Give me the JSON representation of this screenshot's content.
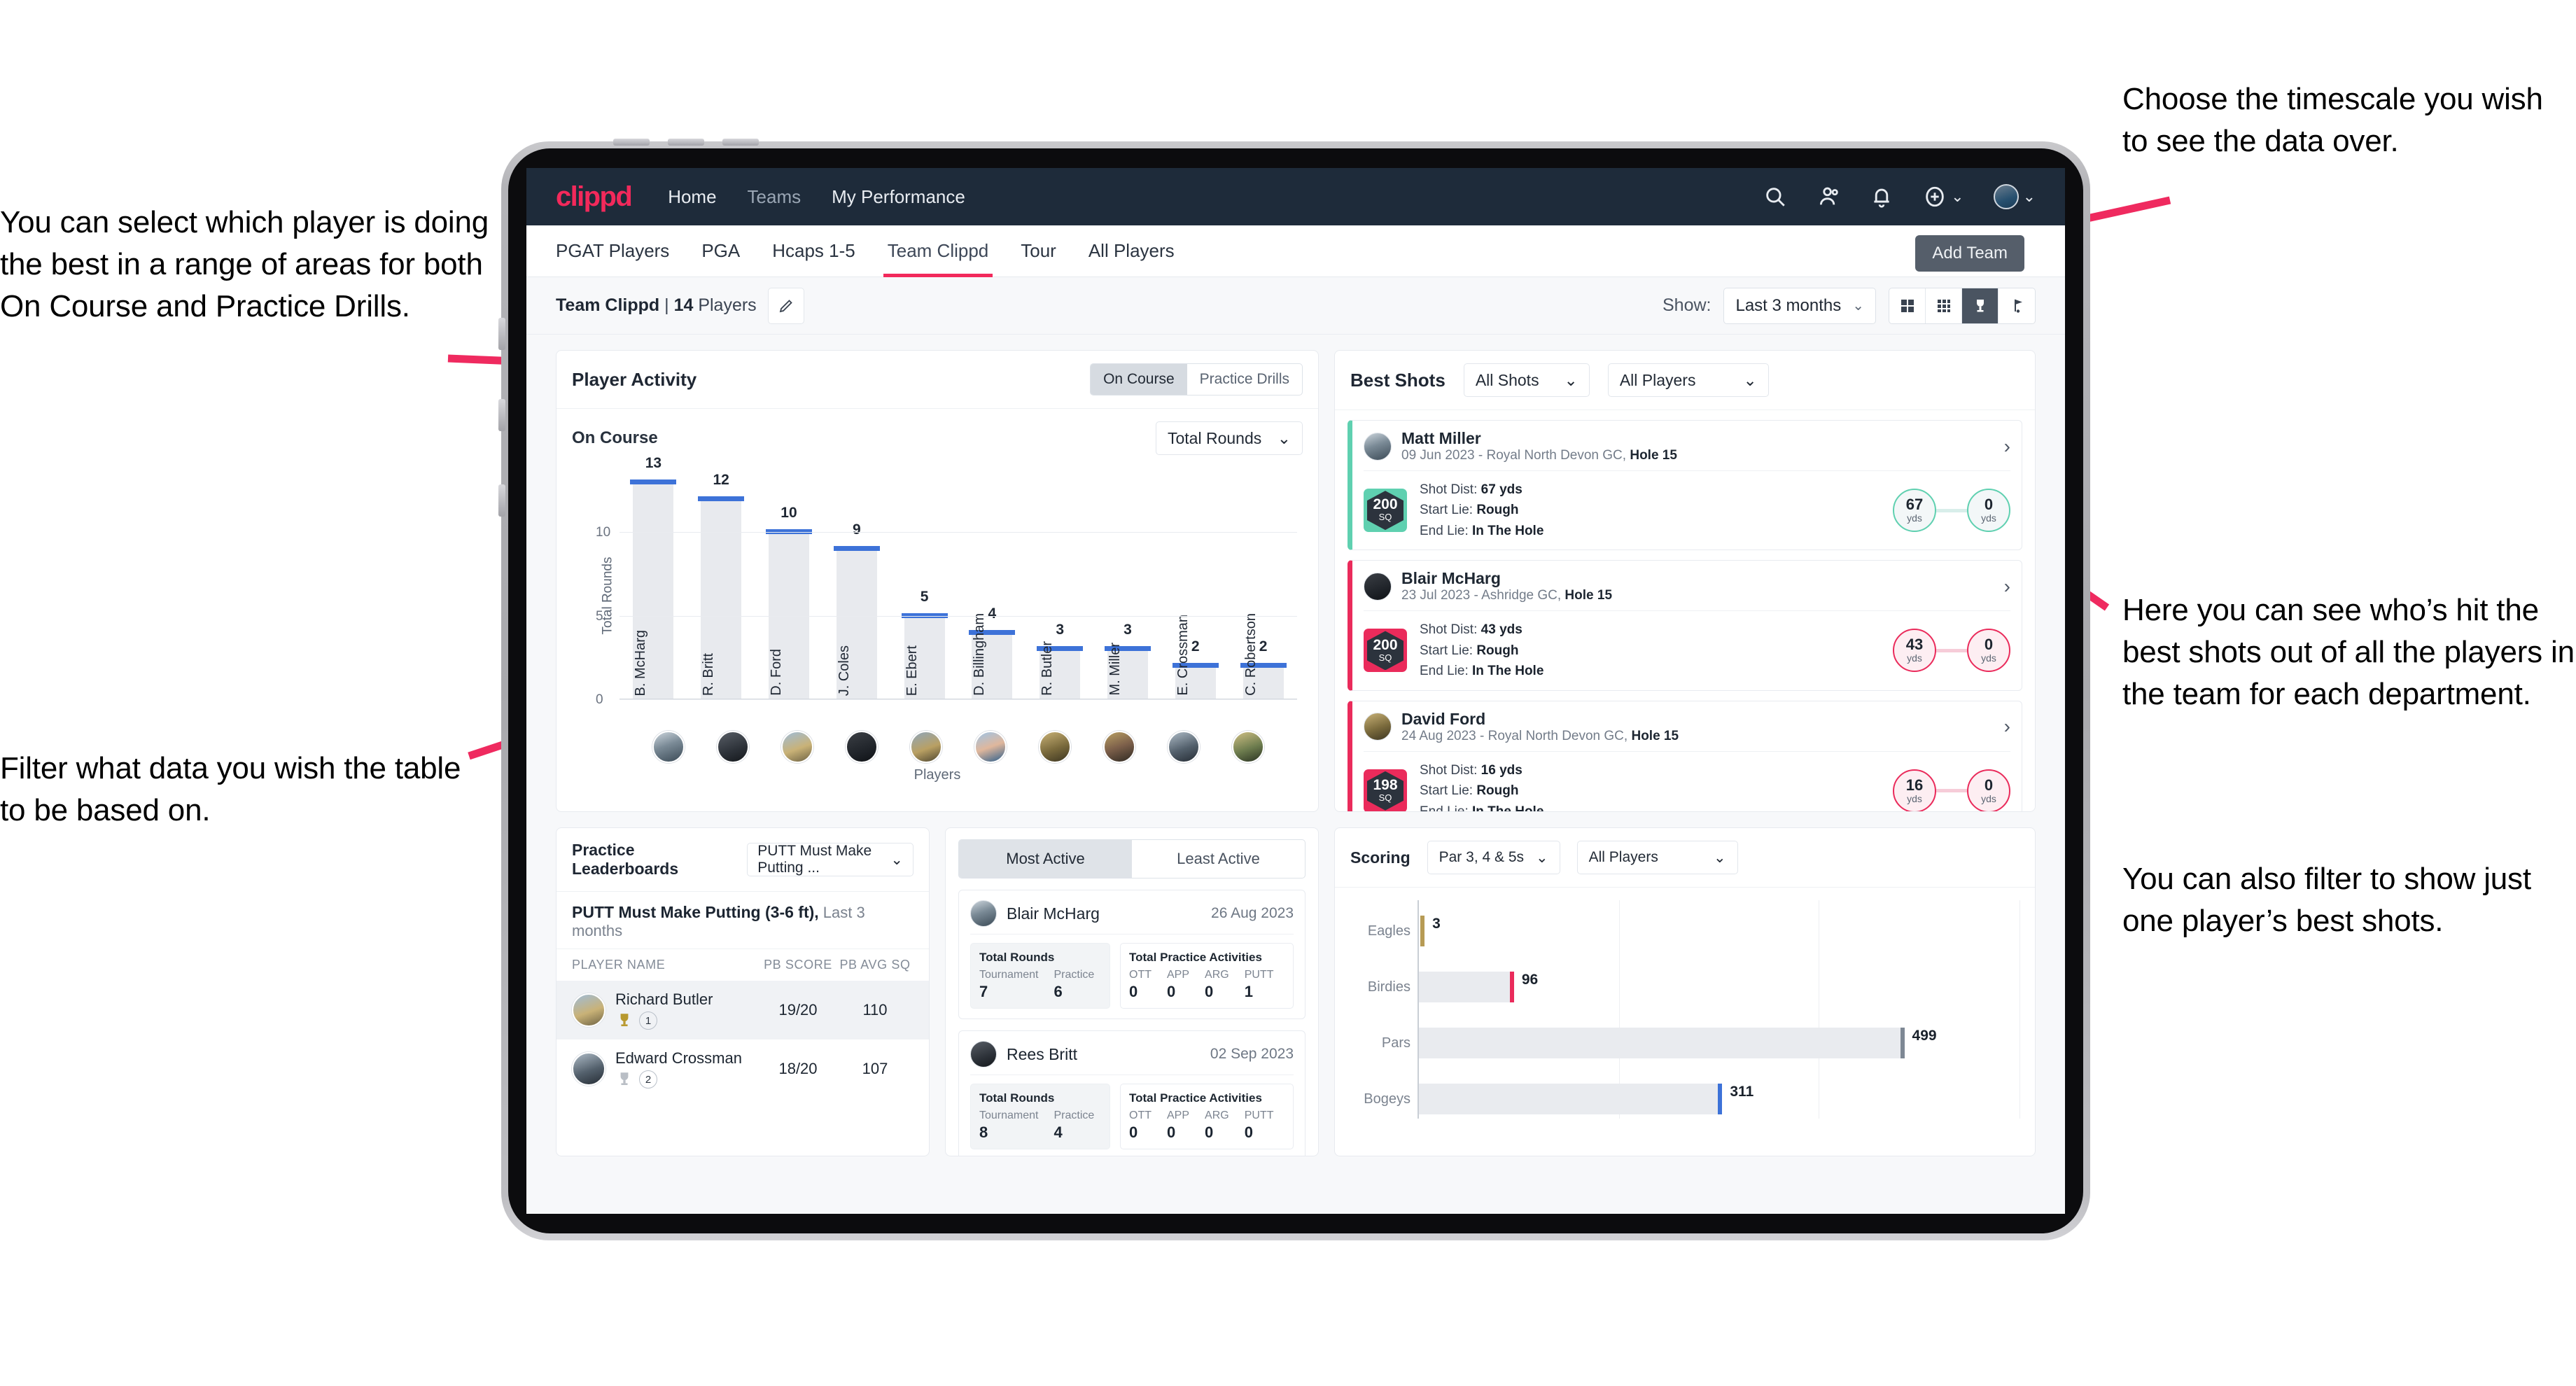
{
  "annotations": {
    "left_top": "You can select which player is doing the best in a range of areas for both On Course and Practice Drills.",
    "left_bottom": "Filter what data you wish the table to be based on.",
    "right_top": "Choose the timescale you wish to see the data over.",
    "right_middle": "Here you can see who’s hit the best shots out of all the players in the team for each department.",
    "right_bottom": "You can also filter to show just one player’s best shots."
  },
  "app": {
    "brand": "clippd",
    "nav_links": [
      {
        "label": "Home"
      },
      {
        "label": "Teams"
      },
      {
        "label": "My Performance"
      }
    ],
    "nav_icons": [
      "search-icon",
      "people-icon",
      "bell-icon",
      "plus-circle-icon",
      "avatar-icon"
    ],
    "tabs": [
      {
        "label": "PGAT Players",
        "active": false
      },
      {
        "label": "PGA",
        "active": false
      },
      {
        "label": "Hcaps 1-5",
        "active": false
      },
      {
        "label": "Team Clippd",
        "active": true
      },
      {
        "label": "Tour",
        "active": false
      },
      {
        "label": "All Players",
        "active": false
      }
    ],
    "add_team_button": "Add Team"
  },
  "subheader": {
    "team_name": "Team Clippd",
    "separator": " | ",
    "player_count": "14",
    "players_word": " Players",
    "edit_icon": "pencil-icon",
    "show_label": "Show:",
    "timescale_value": "Last 3 months",
    "view_toggles": [
      "grid-large-icon",
      "grid-small-icon",
      "trophy-icon",
      "flag-icon"
    ],
    "active_view": 2
  },
  "player_activity": {
    "title": "Player Activity",
    "segments": [
      {
        "label": "On Course",
        "active": true
      },
      {
        "label": "Practice Drills",
        "active": false
      }
    ],
    "sub_title": "On Course",
    "metric_select": "Total Rounds"
  },
  "best_shots": {
    "title": "Best Shots",
    "filter_shots": "All Shots",
    "filter_players": "All Players",
    "cards": [
      {
        "name": "Matt Miller",
        "meta_date": "09 Jun 2023",
        "meta_course": " - Royal North Devon GC, ",
        "meta_hole": "Hole 15",
        "hex_value": "200",
        "hex_unit": "SQ",
        "accent": "#5fd0b0",
        "shot_dist_label": "Shot Dist: ",
        "shot_dist": "67 yds",
        "start_lie_label": "Start Lie: ",
        "start_lie": "Rough",
        "end_lie_label": "End Lie: ",
        "end_lie": "In The Hole",
        "from_value": "67",
        "from_unit": "yds",
        "to_value": "0",
        "to_unit": "yds"
      },
      {
        "name": "Blair McHarg",
        "meta_date": "23 Jul 2023",
        "meta_course": " - Ashridge GC, ",
        "meta_hole": "Hole 15",
        "hex_value": "200",
        "hex_unit": "SQ",
        "accent": "#ea2b5b",
        "shot_dist_label": "Shot Dist: ",
        "shot_dist": "43 yds",
        "start_lie_label": "Start Lie: ",
        "start_lie": "Rough",
        "end_lie_label": "End Lie: ",
        "end_lie": "In The Hole",
        "from_value": "43",
        "from_unit": "yds",
        "to_value": "0",
        "to_unit": "yds"
      },
      {
        "name": "David Ford",
        "meta_date": "24 Aug 2023",
        "meta_course": " - Royal North Devon GC, ",
        "meta_hole": "Hole 15",
        "hex_value": "198",
        "hex_unit": "SQ",
        "accent": "#ea2b5b",
        "shot_dist_label": "Shot Dist: ",
        "shot_dist": "16 yds",
        "start_lie_label": "Start Lie: ",
        "start_lie": "Rough",
        "end_lie_label": "End Lie: ",
        "end_lie": "In The Hole",
        "from_value": "16",
        "from_unit": "yds",
        "to_value": "0",
        "to_unit": "yds"
      }
    ]
  },
  "practice_leaderboards": {
    "title": "Practice Leaderboards",
    "drill_select": "PUTT Must Make Putting ...",
    "subtitle_bold": "PUTT Must Make Putting (3-6 ft),",
    "subtitle_rest": " Last 3 months",
    "columns": [
      "PLAYER NAME",
      "PB SCORE",
      "PB AVG SQ"
    ],
    "rows": [
      {
        "name": "Richard Butler",
        "rank": "1",
        "trophy": "gold",
        "pb_score": "19/20",
        "pb_avg_sq": "110",
        "highlight": true
      },
      {
        "name": "Edward Crossman",
        "rank": "2",
        "trophy": "silver",
        "pb_score": "18/20",
        "pb_avg_sq": "107",
        "highlight": false
      }
    ]
  },
  "activity_panel": {
    "tabs": [
      {
        "label": "Most Active",
        "active": true
      },
      {
        "label": "Least Active",
        "active": false
      }
    ],
    "items": [
      {
        "name": "Blair McHarg",
        "date": "26 Aug 2023",
        "rounds_title": "Total Rounds",
        "rounds": [
          {
            "k": "Tournament",
            "v": "7"
          },
          {
            "k": "Practice",
            "v": "6"
          }
        ],
        "practice_title": "Total Practice Activities",
        "practice": [
          {
            "k": "OTT",
            "v": "0"
          },
          {
            "k": "APP",
            "v": "0"
          },
          {
            "k": "ARG",
            "v": "0"
          },
          {
            "k": "PUTT",
            "v": "1"
          }
        ]
      },
      {
        "name": "Rees Britt",
        "date": "02 Sep 2023",
        "rounds_title": "Total Rounds",
        "rounds": [
          {
            "k": "Tournament",
            "v": "8"
          },
          {
            "k": "Practice",
            "v": "4"
          }
        ],
        "practice_title": "Total Practice Activities",
        "practice": [
          {
            "k": "OTT",
            "v": "0"
          },
          {
            "k": "APP",
            "v": "0"
          },
          {
            "k": "ARG",
            "v": "0"
          },
          {
            "k": "PUTT",
            "v": "0"
          }
        ]
      }
    ]
  },
  "scoring": {
    "title": "Scoring",
    "filter_par": "Par 3, 4 & 5s",
    "filter_players": "All Players"
  },
  "chart_data": [
    {
      "type": "bar",
      "title": "Player Activity — On Course",
      "xlabel": "Players",
      "ylabel": "Total Rounds",
      "ylim": [
        0,
        14
      ],
      "yticks": [
        0,
        5,
        10
      ],
      "grid": true,
      "categories": [
        "B. McHarg",
        "R. Britt",
        "D. Ford",
        "J. Coles",
        "E. Ebert",
        "D. Billingham",
        "R. Butler",
        "M. Miller",
        "E. Crossman",
        "C. Robertson"
      ],
      "values": [
        13,
        12,
        10,
        9,
        5,
        4,
        3,
        3,
        2,
        2
      ],
      "bar_color": "#e8eaee",
      "cap_color": "#3d72d8"
    },
    {
      "type": "bar",
      "orientation": "horizontal",
      "title": "Scoring",
      "xlabel": "",
      "ylabel": "",
      "categories": [
        "Eagles",
        "Birdies",
        "Pars",
        "Bogeys"
      ],
      "values": [
        3,
        96,
        499,
        311
      ],
      "xlim": [
        0,
        620
      ],
      "cap_colors": [
        "#b79b55",
        "#ea2b5b",
        "#7e8894",
        "#3d72d8"
      ],
      "bar_color": "#e9ebef",
      "grid": true
    }
  ],
  "colors": {
    "brand_pink": "#f2295b",
    "nav_dark": "#1e2b3a",
    "page_bg": "#f7f8fa",
    "accent_blue": "#3d72d8",
    "accent_teal": "#5fd0b0"
  }
}
